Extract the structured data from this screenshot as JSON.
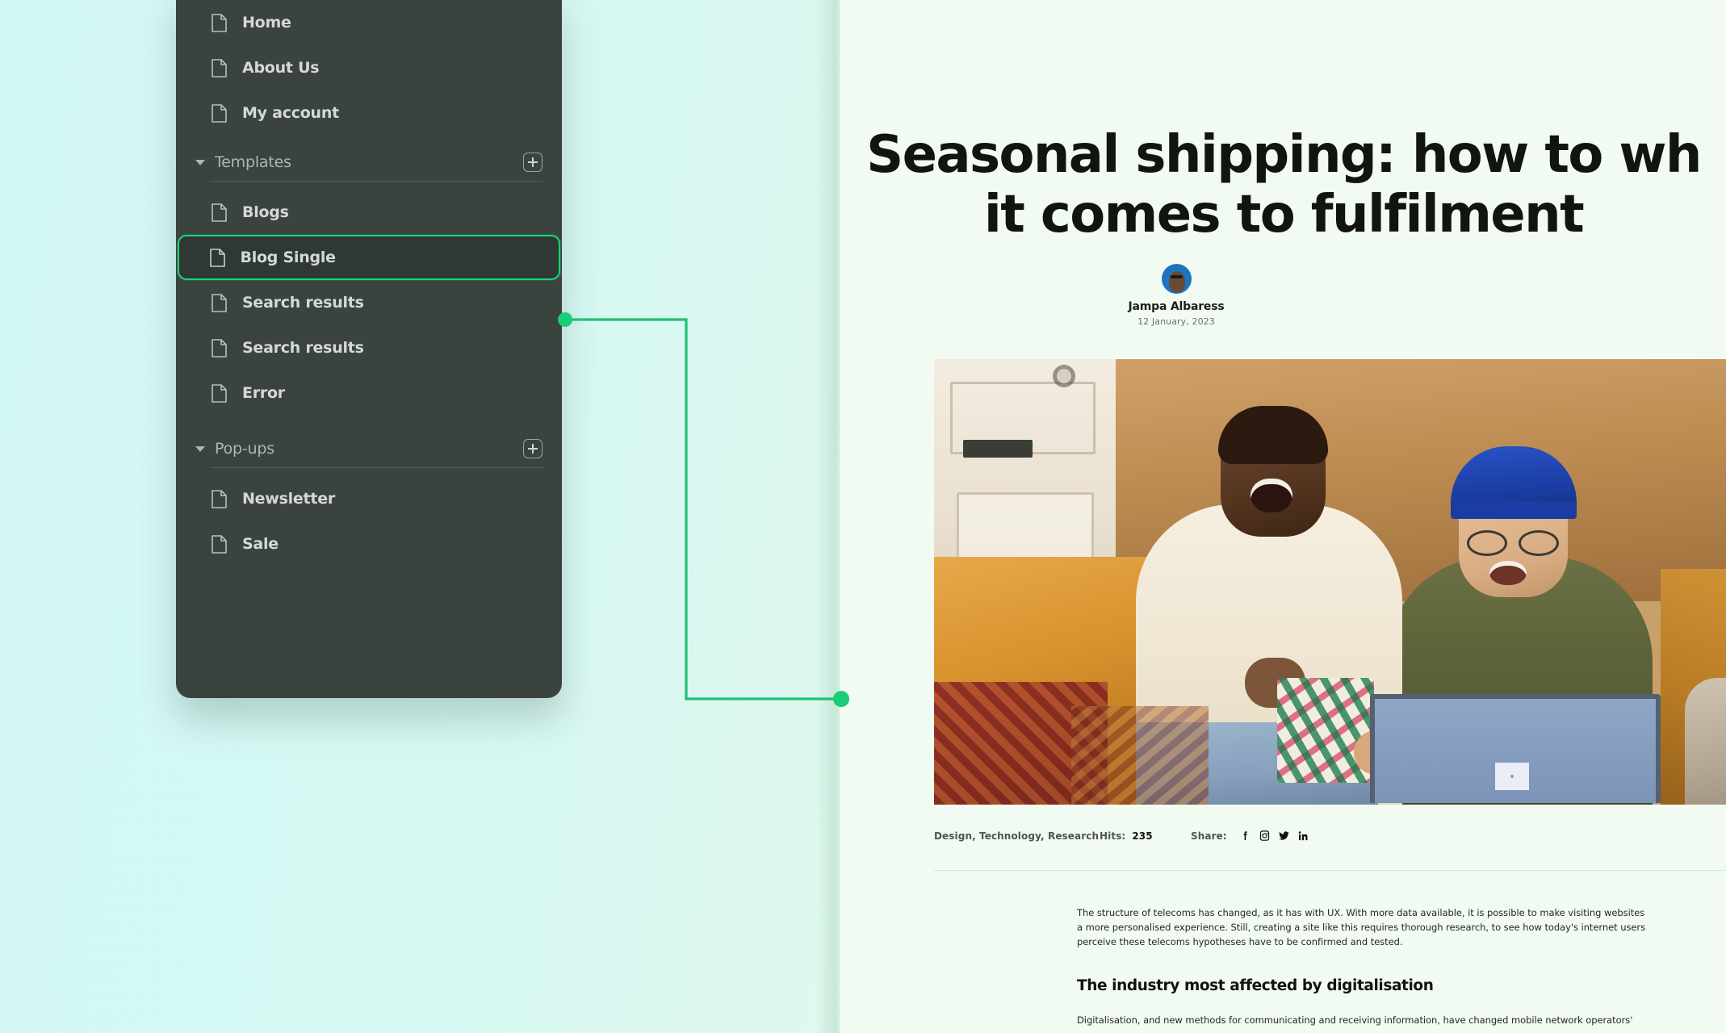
{
  "theme": {
    "accent": "#19d477",
    "sidebar_bg": "#3b433f",
    "canvas_bg": "#d5f7f4",
    "panel_bg": "#f2fbf1"
  },
  "sidebar": {
    "top_items": [
      {
        "label": "Home",
        "icon": "document-icon"
      },
      {
        "label": "About Us",
        "icon": "document-icon"
      },
      {
        "label": "My account",
        "icon": "document-icon"
      }
    ],
    "sections": [
      {
        "label": "Templates",
        "caret": "caret-down-icon",
        "add": "plus-icon",
        "items": [
          {
            "label": "Blogs",
            "icon": "document-icon",
            "selected": false
          },
          {
            "label": "Blog Single",
            "icon": "document-icon",
            "selected": true
          },
          {
            "label": "Search results",
            "icon": "document-icon",
            "selected": false
          },
          {
            "label": "Search results",
            "icon": "document-icon",
            "selected": false
          },
          {
            "label": "Error",
            "icon": "document-icon",
            "selected": false
          }
        ]
      },
      {
        "label": "Pop-ups",
        "caret": "caret-down-icon",
        "add": "plus-icon",
        "items": [
          {
            "label": "Newsletter",
            "icon": "document-icon",
            "selected": false
          },
          {
            "label": "Sale",
            "icon": "document-icon",
            "selected": false
          }
        ]
      }
    ]
  },
  "preview": {
    "title_line1": "Seasonal shipping: how to wh",
    "title_line2": "it comes to fulfilment",
    "author": {
      "name": "Jampa Albaress",
      "date": "12 January, 2023",
      "avatar": "avatar-image"
    },
    "hero_image_alt": "two people laughing on a sofa with a laptop",
    "meta": {
      "tags": "Design, Technology, Research",
      "hits_label": "Hits:",
      "hits_value": "235",
      "share_label": "Share:",
      "share_icons": [
        "facebook-icon",
        "instagram-icon",
        "twitter-icon",
        "linkedin-icon"
      ]
    },
    "body": {
      "paragraph1": "The structure of telecoms has changed, as it has with UX. With more data available, it is possible to make visiting websites a more personalised experience. Still, creating a site like this requires thorough research, to see how today's internet users perceive these telecoms hypotheses have to be confirmed and tested.",
      "heading2": "The industry most affected by digitalisation",
      "paragraph2": "Digitalisation, and new methods for communicating and receiving information, have changed mobile network operators'"
    }
  }
}
